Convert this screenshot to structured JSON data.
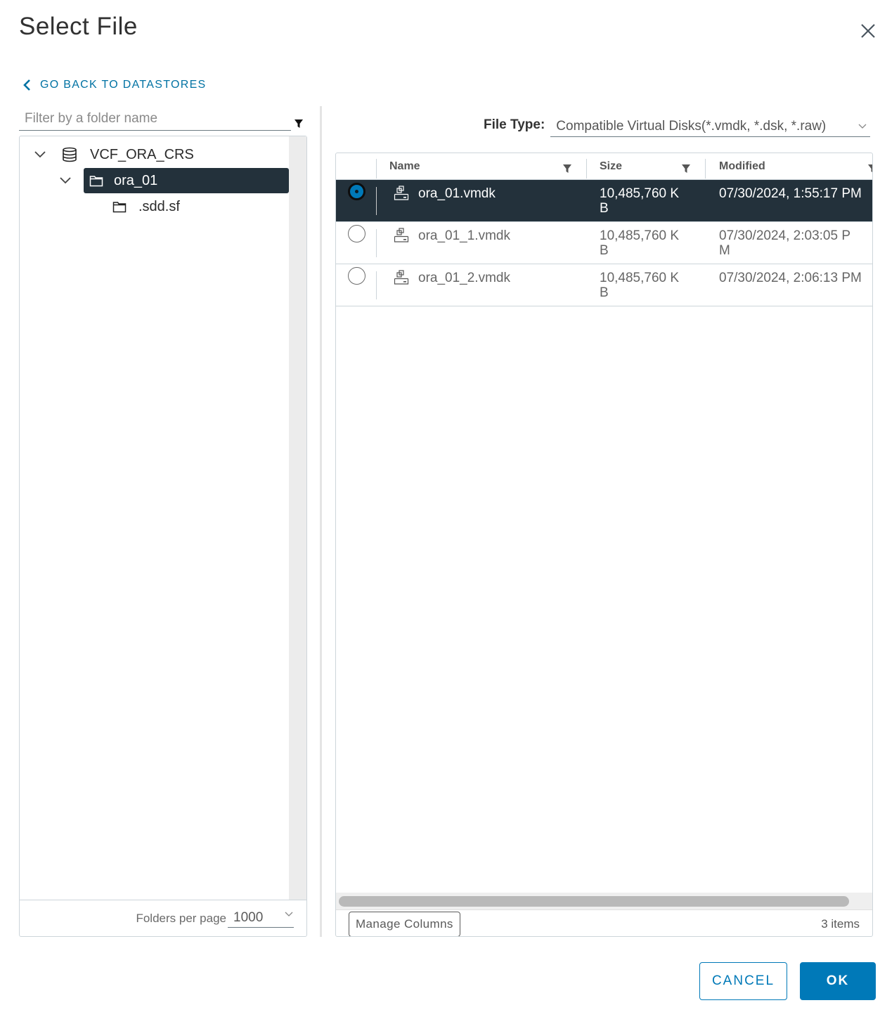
{
  "dialog": {
    "title": "Select File",
    "close_icon": "close-icon"
  },
  "back_link": {
    "label": "GO BACK TO DATASTORES",
    "icon": "chevron-left-icon"
  },
  "folder_tree": {
    "filter_placeholder": "Filter by a folder name",
    "filter_value": "",
    "filter_icon": "filter-icon",
    "nodes": [
      {
        "label": "VCF_ORA_CRS",
        "icon": "datastore-icon",
        "expanded": true,
        "level": 0,
        "selected": false
      },
      {
        "label": "ora_01",
        "icon": "folder-icon",
        "expanded": true,
        "level": 1,
        "selected": true
      },
      {
        "label": ".sdd.sf",
        "icon": "folder-icon",
        "expanded": false,
        "level": 2,
        "selected": false
      }
    ],
    "footer": {
      "per_page_label": "Folders per page",
      "per_page_value": "1000"
    }
  },
  "file_type": {
    "label": "File Type:",
    "value": "Compatible Virtual Disks(*.vmdk, *.dsk, *.raw)"
  },
  "file_grid": {
    "columns": [
      {
        "label": "Name",
        "filterable": true
      },
      {
        "label": "Size",
        "filterable": true
      },
      {
        "label": "Modified",
        "filterable": true
      }
    ],
    "rows": [
      {
        "name": "ora_01.vmdk",
        "size_line1": "10,485,760 K",
        "size_line2": "B",
        "modified_line1": "07/30/2024, 1:55:17 PM",
        "modified_line2": "",
        "selected": true
      },
      {
        "name": "ora_01_1.vmdk",
        "size_line1": "10,485,760 K",
        "size_line2": "B",
        "modified_line1": "07/30/2024, 2:03:05 P",
        "modified_line2": "M",
        "selected": false
      },
      {
        "name": "ora_01_2.vmdk",
        "size_line1": "10,485,760 K",
        "size_line2": "B",
        "modified_line1": "07/30/2024, 2:06:13 PM",
        "modified_line2": "",
        "selected": false
      }
    ],
    "manage_columns_label": "Manage Columns",
    "items_count": "3 items"
  },
  "actions": {
    "cancel_label": "CANCEL",
    "ok_label": "OK"
  },
  "colors": {
    "accent": "#0079b8",
    "selected_row_bg": "#23313b"
  }
}
